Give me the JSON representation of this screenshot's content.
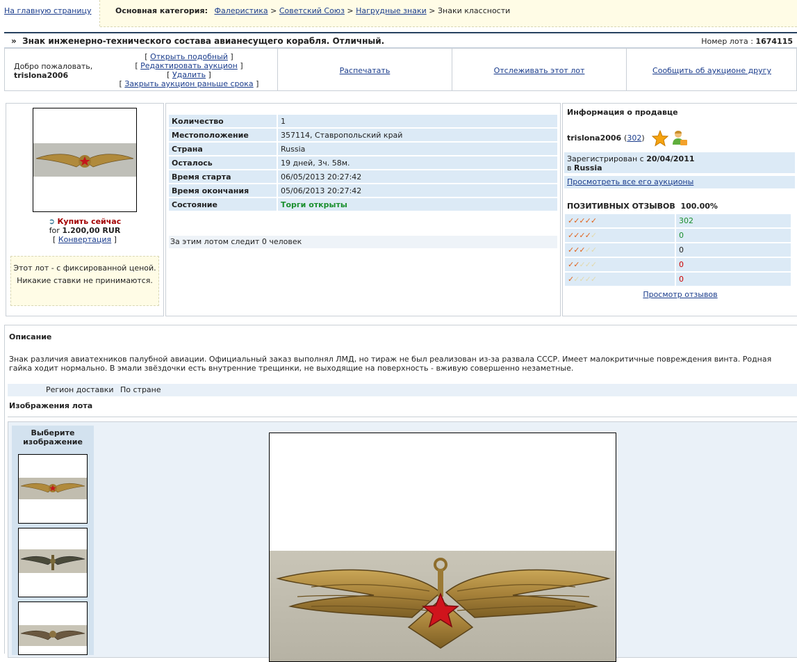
{
  "top": {
    "home_link": "На главную страницу",
    "category_label": "Основная категория:",
    "breadcrumb": [
      "Фалеристика",
      "Советский Союз",
      "Нагрудные знаки"
    ],
    "breadcrumb_current": "Знаки классности",
    "separator": ">"
  },
  "title": {
    "marker": "»",
    "text": "Знак инженерно-технического состава авианесущего корабля. Отличный.",
    "lot_label": "Номер лота :",
    "lot_number": "1674115"
  },
  "actions": {
    "welcome": "Добро пожаловать,",
    "username": "trislona2006",
    "controls": [
      "Открыть подобный",
      "Редактировать аукцион",
      "Удалить",
      "Закрыть аукцион раньше срока"
    ],
    "print": "Распечатать",
    "track": "Отслеживать этот лот",
    "tell_friend": "Сообщить об аукционе другу"
  },
  "buy": {
    "buy_now": "Купить сейчас",
    "for": "for",
    "price": "1.200,00 RUR",
    "convert": "Конвертация",
    "fixed_note": "Этот лот - с фиксированной ценой. Никакие ставки не принимаются."
  },
  "details": {
    "rows": [
      {
        "k": "Количество",
        "v": "1"
      },
      {
        "k": "Местоположение",
        "v": "357114, Ставропольский край"
      },
      {
        "k": "Страна",
        "v": "Russia"
      },
      {
        "k": "Осталось",
        "v": "19 дней, 3ч. 58м."
      },
      {
        "k": "Время старта",
        "v": "06/05/2013 20:27:42"
      },
      {
        "k": "Время окончания",
        "v": "05/06/2013 20:27:42"
      },
      {
        "k": "Состояние",
        "v": "Торги открыты"
      }
    ],
    "watchers": "За этим лотом следит 0 человек"
  },
  "seller": {
    "header": "Информация о продавце",
    "name": "trislona2006",
    "rating": "302",
    "registered_label": "Зарегистрирован с",
    "registered_date": "20/04/2011",
    "in": "в",
    "country": "Russia",
    "all_auctions": "Просмотреть все его аукционы",
    "positive_label": "ПОЗИТИВНЫХ ОТЗЫВОВ",
    "positive_value": "100.00%",
    "feedback_counts": [
      "302",
      "0",
      "0",
      "0",
      "0"
    ],
    "view_feedback": "Просмотр отзывов",
    "colors": {
      "positive": "#1a8f2e",
      "negative": "#cc0000",
      "check": "#e0621b"
    }
  },
  "description": {
    "header": "Описание",
    "text": "Знак различия авиатехников палубной авиации. Официальный заказ выполнял ЛМД, но тираж не был реализован из-за развала СССР. Имеет малокритичные повреждения винта. Родная гайка ходит нормально. В эмали звёздочки есть внутренние трещинки, не выходящие на поверхность - вживую совершенно незаметные.",
    "delivery_label": "Регион доставки",
    "delivery_value": "По стране",
    "images_header": "Изображения лота",
    "pick_image": "Выберите изображение"
  }
}
